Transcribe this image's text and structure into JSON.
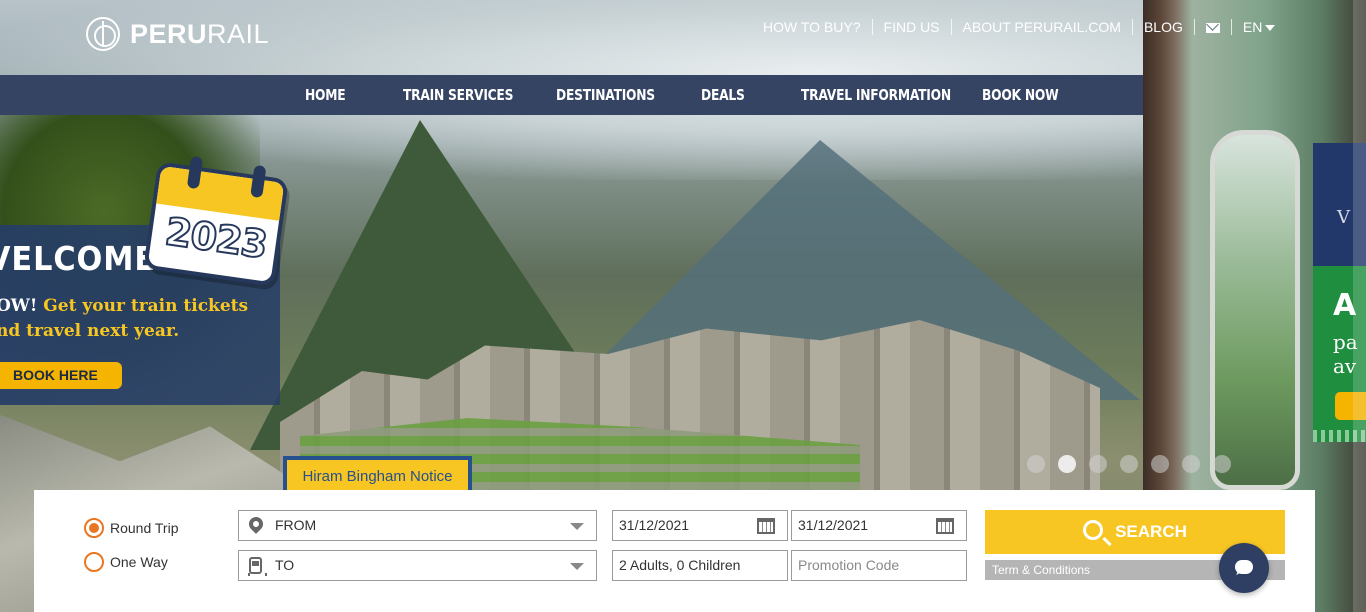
{
  "brand": {
    "logo_bold": "PERU",
    "logo_thin": "RAIL"
  },
  "topnav": {
    "items": [
      "HOW TO BUY?",
      "FIND US",
      "ABOUT PERURAIL.COM",
      "BLOG"
    ],
    "mail_icon": "mail-icon",
    "language": "EN"
  },
  "mainnav": {
    "items": [
      "HOME",
      "TRAIN SERVICES",
      "DESTINATIONS",
      "DEALS",
      "TRAVEL INFORMATION",
      "BOOK NOW"
    ]
  },
  "slide": {
    "title": "VELCOME",
    "line1_white": "OW! ",
    "line1_yellow": "Get your train tickets",
    "line2": "nd travel next year.",
    "year": "2023",
    "cta": "BOOK HERE"
  },
  "side_panel": {
    "blue_letter": "V",
    "green_big": "A",
    "green_line1": "pa",
    "green_line2": "av"
  },
  "carousel": {
    "dot_count": 7,
    "active_index": 1
  },
  "notice": {
    "label": "Hiram Bingham Notice"
  },
  "booking": {
    "trip_type": [
      {
        "label": "Round Trip",
        "selected": true
      },
      {
        "label": "One Way",
        "selected": false
      }
    ],
    "from_placeholder": "FROM",
    "to_placeholder": "TO",
    "departure_date": "31/12/2021",
    "return_date": "31/12/2021",
    "passengers": "2 Adults, 0 Children",
    "promo_placeholder": "Promotion Code",
    "search_label": "SEARCH",
    "terms_label": "Term & Conditions"
  },
  "colors": {
    "nav_bg": "#354463",
    "accent_yellow": "#f7c623",
    "radio_orange": "#e87722",
    "notice_border": "#27508f",
    "promo_green": "#1f8f3f"
  }
}
